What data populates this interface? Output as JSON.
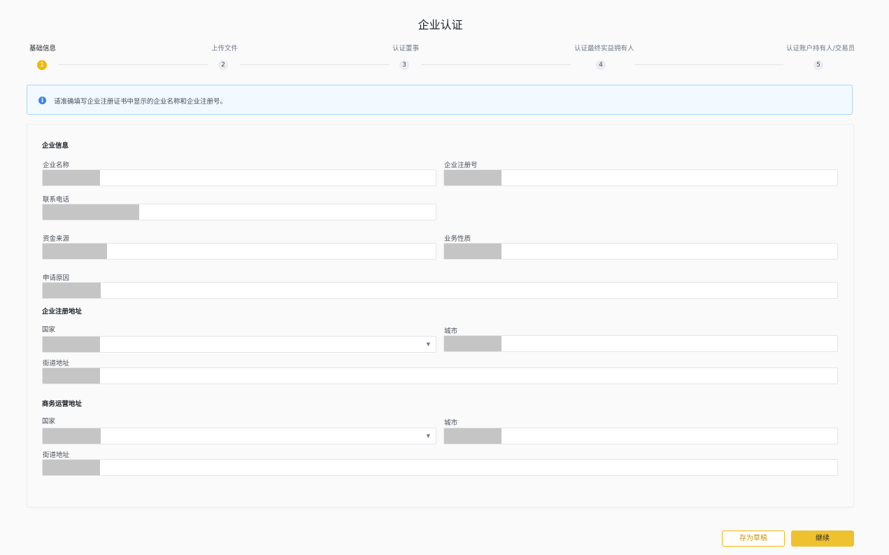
{
  "page": {
    "title": "企业认证"
  },
  "stepper": {
    "steps": [
      {
        "number": "1",
        "label": "基础信息",
        "active": true
      },
      {
        "number": "2",
        "label": "上传文件",
        "active": false
      },
      {
        "number": "3",
        "label": "认证董事",
        "active": false
      },
      {
        "number": "4",
        "label": "认证最终实益拥有人",
        "active": false
      },
      {
        "number": "5",
        "label": "认证账户持有人/交易员",
        "active": false
      }
    ]
  },
  "banner": {
    "icon": "info-icon",
    "text": "请准确填写企业注册证书中显示的企业名称和企业注册号。"
  },
  "company_info": {
    "section_title": "企业信息",
    "company_name": {
      "label": "企业名称",
      "value": ""
    },
    "registration_number": {
      "label": "企业注册号",
      "value": ""
    },
    "phone": {
      "label": "联系电话",
      "value": ""
    },
    "fund_source": {
      "label": "资金来源",
      "value": ""
    },
    "business_nature": {
      "label": "业务性质",
      "value": ""
    },
    "application_reason": {
      "label": "申请原因",
      "value": ""
    }
  },
  "registered_address": {
    "section_title": "企业注册地址",
    "country": {
      "label": "国家",
      "value": ""
    },
    "city": {
      "label": "城市",
      "value": ""
    },
    "street": {
      "label": "街道地址",
      "value": ""
    }
  },
  "operating_address": {
    "section_title": "商务运营地址",
    "country": {
      "label": "国家",
      "value": ""
    },
    "city": {
      "label": "城市",
      "value": ""
    },
    "street": {
      "label": "街道地址",
      "value": ""
    }
  },
  "actions": {
    "save_draft": "存为草稿",
    "continue": "继续"
  },
  "colors": {
    "accent": "#f0b90b",
    "info": "#3e84e0",
    "banner_bg": "#f2f9ff"
  }
}
